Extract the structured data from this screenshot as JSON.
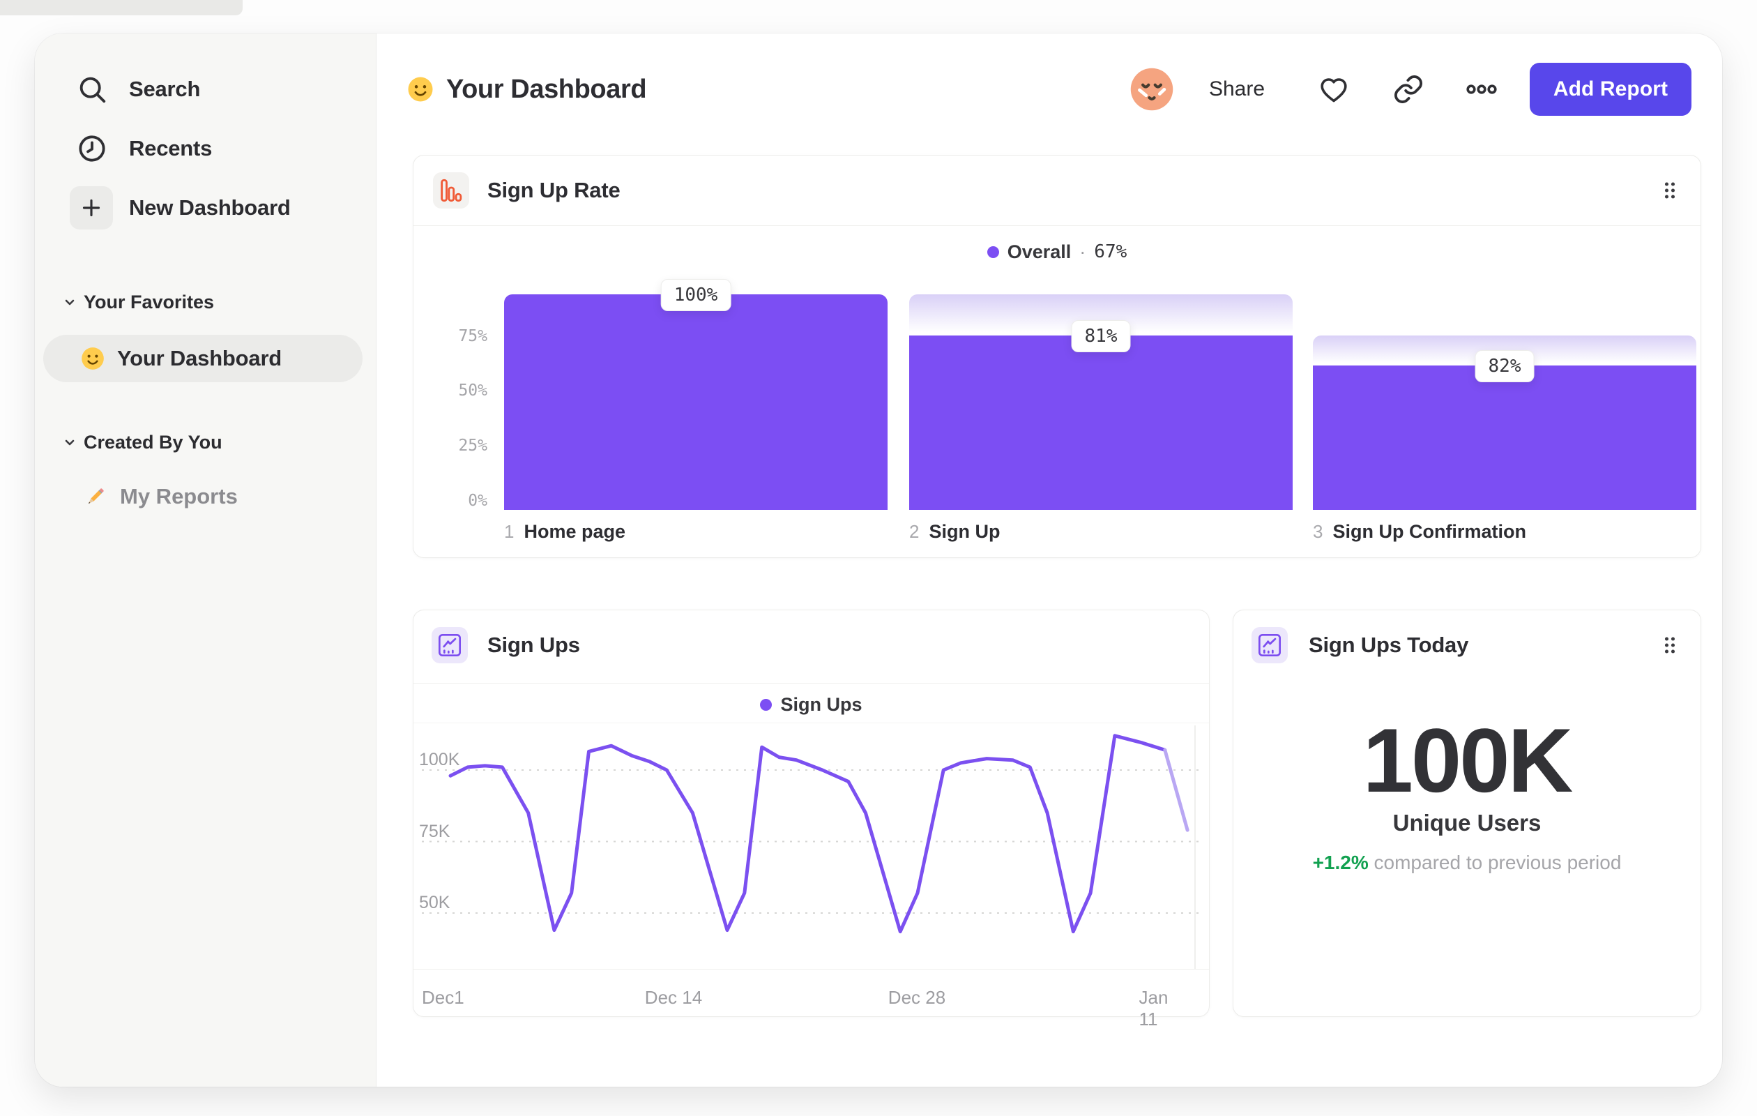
{
  "sidebar": {
    "items": [
      {
        "label": "Search",
        "icon": "search-icon"
      },
      {
        "label": "Recents",
        "icon": "clock-icon"
      },
      {
        "label": "New Dashboard",
        "icon": "plus-icon"
      }
    ],
    "sections": [
      {
        "label": "Your Favorites",
        "items": [
          {
            "label": "Your Dashboard",
            "icon": "smiley-emoji-icon",
            "selected": true
          }
        ]
      },
      {
        "label": "Created By You",
        "items": [
          {
            "label": "My Reports",
            "icon": "pencil-emoji-icon",
            "selected": false
          }
        ]
      }
    ]
  },
  "header": {
    "title": "Your Dashboard",
    "share_label": "Share",
    "add_report_label": "Add Report"
  },
  "colors": {
    "accent_purple": "#7c4ef3",
    "dropoff_gradient_top": "#d9d0f7",
    "faded_line": "#b9a7f3",
    "button_indigo": "#5847eb",
    "icon_orange": "#f05a36",
    "positive_green": "#12a150",
    "sidebar_bg": "#f7f7f5",
    "avatar_peach": "#f5a480"
  },
  "cards": {
    "signup_rate": {
      "icon": "bar-chart-icon",
      "title": "Sign Up Rate",
      "legend": {
        "label": "Overall",
        "separator": "·",
        "value": "67%"
      },
      "chart": {
        "type": "bar",
        "ylim": [
          0,
          100
        ],
        "y_ticks": [
          "75%",
          "50%",
          "25%",
          "0%"
        ],
        "steps": [
          {
            "num": "1",
            "label": "Home page",
            "conversion_label": "100%",
            "pct_of_total": 100,
            "prev_pct_of_total": 100
          },
          {
            "num": "2",
            "label": "Sign Up",
            "conversion_label": "81%",
            "pct_of_total": 81,
            "prev_pct_of_total": 100
          },
          {
            "num": "3",
            "label": "Sign Up Confirmation",
            "conversion_label": "82%",
            "pct_of_total": 67,
            "prev_pct_of_total": 81
          }
        ]
      }
    },
    "sign_ups": {
      "icon": "line-chart-icon",
      "title": "Sign Ups",
      "legend": {
        "label": "Sign Ups"
      },
      "chart": {
        "type": "line",
        "unit": "K",
        "y_ticks": [
          "100K",
          "75K",
          "50K"
        ],
        "y_gridlines_k": [
          100,
          75,
          50
        ],
        "x_ticks": [
          "Dec1",
          "Dec 14",
          "Dec 28",
          "Jan 11"
        ],
        "x_tick_days": [
          0,
          13,
          27,
          41
        ],
        "x_range_days": [
          0,
          43
        ],
        "points": [
          [
            0,
            98
          ],
          [
            1,
            101
          ],
          [
            2,
            101.5
          ],
          [
            3,
            101
          ],
          [
            4.5,
            85
          ],
          [
            6,
            44
          ],
          [
            7,
            57
          ],
          [
            8,
            106.5
          ],
          [
            9.3,
            108.5
          ],
          [
            10.5,
            105
          ],
          [
            11.5,
            103
          ],
          [
            12.5,
            100
          ],
          [
            14,
            85
          ],
          [
            16,
            44
          ],
          [
            17,
            57
          ],
          [
            18,
            108
          ],
          [
            19,
            104.5
          ],
          [
            20,
            103.5
          ],
          [
            21.5,
            100
          ],
          [
            23,
            96
          ],
          [
            24,
            85
          ],
          [
            26,
            43.5
          ],
          [
            27,
            57
          ],
          [
            28.5,
            100
          ],
          [
            29.5,
            102.5
          ],
          [
            31,
            104
          ],
          [
            32.5,
            103.5
          ],
          [
            33.5,
            101
          ],
          [
            34.5,
            85
          ],
          [
            36,
            43.5
          ],
          [
            37,
            57
          ],
          [
            38.4,
            112
          ],
          [
            40,
            109.5
          ],
          [
            41.3,
            107
          ],
          [
            42.6,
            79
          ]
        ],
        "faded_from_index": 33
      }
    },
    "sign_ups_today": {
      "icon": "line-chart-icon",
      "title": "Sign Ups Today",
      "value": "100K",
      "metric_label": "Unique Users",
      "delta": "+1.2%",
      "delta_note": "compared to previous period"
    }
  }
}
